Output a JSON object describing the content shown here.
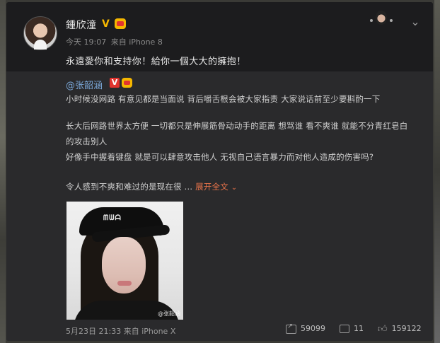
{
  "post": {
    "username": "鍾欣潼",
    "verified_badge": "V",
    "time": "今天 19:07",
    "source": "来自 iPhone 8",
    "text": "永遠愛你和支持你！給你一個大大的擁抱！"
  },
  "repost": {
    "username": "@张韶涵",
    "verified_badge": "V",
    "lines": [
      "小时候没网路 有意见都是当面说 背后嚼舌根会被大家指责 大家说话前至少要斟酌一下",
      "长大后网路世界太方便 一切都只是伸展筋骨动动手的距离 想骂谁 看不爽谁 就能不分青红皂白",
      "的攻击别人",
      "好像手中握着键盘 就是可以肆意攻击他人 无视自己语言暴力而对他人造成的伤害吗?",
      "令人感到不爽和难过的是现在很 ..."
    ],
    "expand_label": "展开全文",
    "photo": {
      "cap_mark": "ᗰᗯᗩ",
      "watermark": "@张韶涵"
    },
    "time": "5月23日 21:33",
    "source": "来自 iPhone X",
    "reposts": "59099",
    "comments": "11",
    "likes": "159122"
  },
  "icons": [
    "more-chevron-icon",
    "share-icon",
    "comment-icon",
    "like-icon"
  ]
}
